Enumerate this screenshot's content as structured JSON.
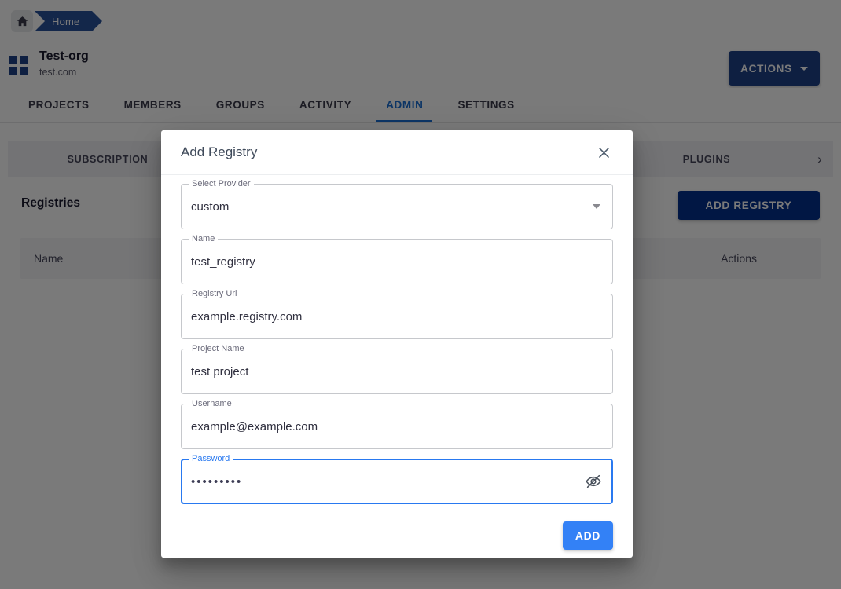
{
  "breadcrumb": {
    "home_icon": "home-icon",
    "items": [
      {
        "label": "Home"
      }
    ]
  },
  "org": {
    "logo_icon": "grid-squares-logo-icon",
    "name": "Test-org",
    "domain": "test.com",
    "actions_button": {
      "label": "ACTIONS",
      "icon": "chevron-down-icon"
    }
  },
  "main_tabs": [
    {
      "label": "PROJECTS",
      "active": false
    },
    {
      "label": "MEMBERS",
      "active": false
    },
    {
      "label": "GROUPS",
      "active": false
    },
    {
      "label": "ACTIVITY",
      "active": false
    },
    {
      "label": "ADMIN",
      "active": true
    },
    {
      "label": "SETTINGS",
      "active": false
    }
  ],
  "sub_nav": {
    "items": [
      {
        "label": "SUBSCRIPTION"
      },
      {
        "label": ""
      },
      {
        "label": ""
      },
      {
        "label": "PLUGINS"
      }
    ],
    "scroll_right_icon": "chevron-right-icon"
  },
  "registries": {
    "section_title": "Registries",
    "add_button_label": "ADD REGISTRY",
    "table": {
      "columns": [
        "Name",
        "Actions"
      ],
      "rows": []
    }
  },
  "dialog": {
    "title": "Add Registry",
    "close_icon": "close-icon",
    "fields": [
      {
        "label": "Select Provider",
        "value": "custom",
        "type": "select",
        "icon": "dropdown-arrow-icon",
        "focused": false
      },
      {
        "label": "Name",
        "value": "test_registry",
        "type": "text",
        "focused": false
      },
      {
        "label": "Registry Url",
        "value": "example.registry.com",
        "type": "text",
        "focused": false
      },
      {
        "label": "Project Name",
        "value": "test project",
        "type": "text",
        "focused": false
      },
      {
        "label": "Username",
        "value": "example@example.com",
        "type": "text",
        "focused": false
      },
      {
        "label": "Password",
        "value": "•••••••••",
        "type": "password",
        "icon": "eye-off-icon",
        "focused": true
      }
    ],
    "submit_label": "ADD"
  },
  "colors": {
    "primary_dark_blue": "#1f4288",
    "add_registry_blue": "#03308e",
    "accent_blue": "#3381f6",
    "focus_blue": "#2979f0",
    "active_tab_blue": "#1a6fd4",
    "scrim": "rgba(0,0,0,0.52)"
  }
}
